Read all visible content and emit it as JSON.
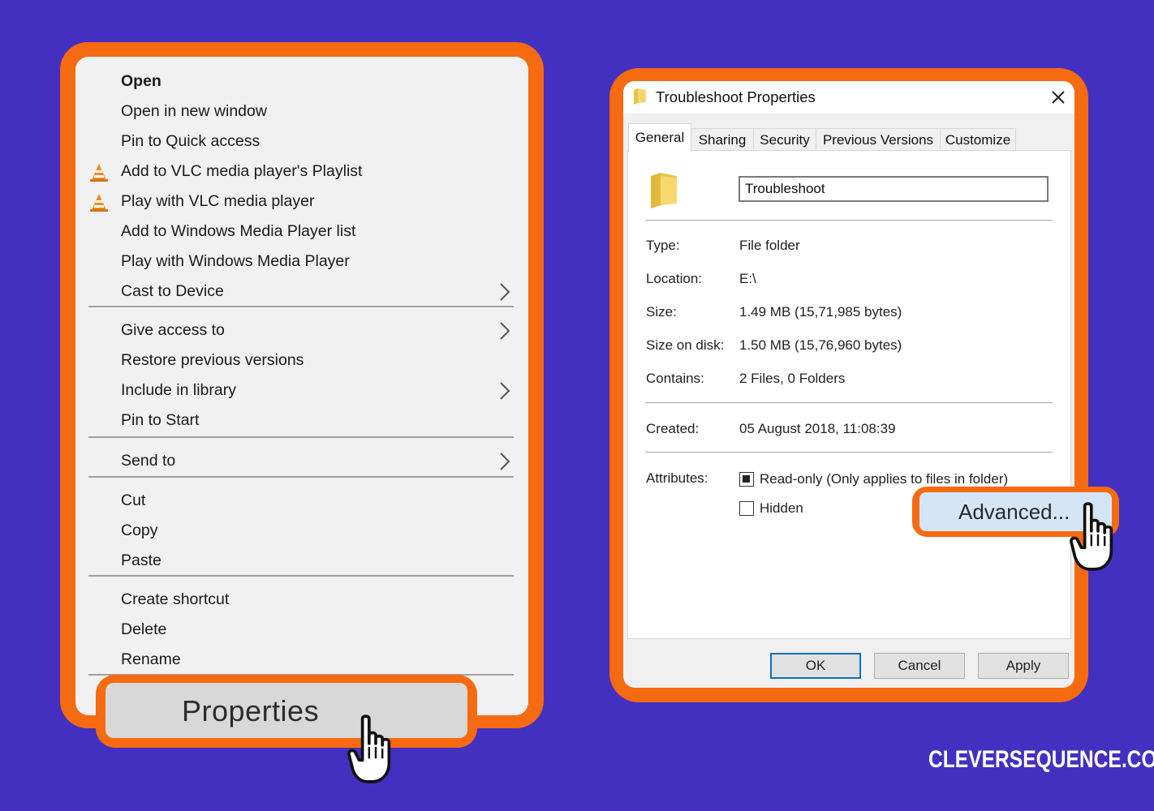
{
  "context_menu": {
    "items": [
      {
        "label": "Open",
        "bold": true,
        "icon": "",
        "submenu": false
      },
      {
        "label": "Open in new window",
        "bold": false,
        "icon": "",
        "submenu": false
      },
      {
        "label": "Pin to Quick access",
        "bold": false,
        "icon": "",
        "submenu": false
      },
      {
        "label": "Add to VLC media player's Playlist",
        "bold": false,
        "icon": "vlc-icon",
        "submenu": false
      },
      {
        "label": "Play with VLC media player",
        "bold": false,
        "icon": "vlc-icon",
        "submenu": false
      },
      {
        "label": "Add to Windows Media Player list",
        "bold": false,
        "icon": "",
        "submenu": false
      },
      {
        "label": "Play with Windows Media Player",
        "bold": false,
        "icon": "",
        "submenu": false
      },
      {
        "label": "Cast to Device",
        "bold": false,
        "icon": "",
        "submenu": true
      },
      {
        "label": "Give access to",
        "bold": false,
        "icon": "",
        "submenu": true
      },
      {
        "label": "Restore previous versions",
        "bold": false,
        "icon": "",
        "submenu": false
      },
      {
        "label": "Include in library",
        "bold": false,
        "icon": "",
        "submenu": true
      },
      {
        "label": "Pin to Start",
        "bold": false,
        "icon": "",
        "submenu": false
      },
      {
        "label": "Send to",
        "bold": false,
        "icon": "",
        "submenu": true
      },
      {
        "label": "Cut",
        "bold": false,
        "icon": "",
        "submenu": false
      },
      {
        "label": "Copy",
        "bold": false,
        "icon": "",
        "submenu": false
      },
      {
        "label": "Paste",
        "bold": false,
        "icon": "",
        "submenu": false
      },
      {
        "label": "Create shortcut",
        "bold": false,
        "icon": "",
        "submenu": false
      },
      {
        "label": "Delete",
        "bold": false,
        "icon": "",
        "submenu": false
      },
      {
        "label": "Rename",
        "bold": false,
        "icon": "",
        "submenu": false
      }
    ],
    "properties_label": "Properties"
  },
  "dialog": {
    "title": "Troubleshoot Properties",
    "tabs": [
      "General",
      "Sharing",
      "Security",
      "Previous Versions",
      "Customize"
    ],
    "active_tab": "General",
    "folder_name": "Troubleshoot",
    "fields": [
      {
        "label": "Type:",
        "value": "File folder"
      },
      {
        "label": "Location:",
        "value": "E:\\"
      },
      {
        "label": "Size:",
        "value": "1.49 MB (15,71,985 bytes)"
      },
      {
        "label": "Size on disk:",
        "value": "1.50 MB (15,76,960 bytes)"
      },
      {
        "label": "Contains:",
        "value": "2 Files, 0 Folders"
      }
    ],
    "created": {
      "label": "Created:",
      "value": "05 August 2018, 11:08:39"
    },
    "attributes": {
      "label": "Attributes:",
      "readonly_label": "Read-only (Only applies to files in folder)",
      "readonly_state": "indeterminate",
      "hidden_label": "Hidden",
      "hidden_checked": false
    },
    "advanced_label": "Advanced...",
    "buttons": {
      "ok": "OK",
      "cancel": "Cancel",
      "apply": "Apply"
    }
  },
  "watermark": "CLEVERSEQUENCE.COM",
  "colors": {
    "background": "#4430c0",
    "highlight_frame": "#f66a12",
    "advanced_button": "#d4e6f6",
    "ok_border": "#0f6ec2"
  }
}
